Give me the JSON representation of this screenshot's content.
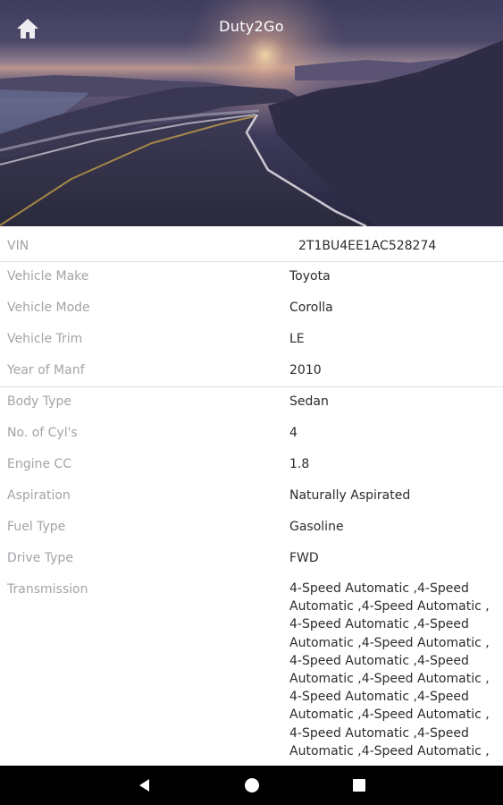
{
  "app": {
    "title": "Duty2Go"
  },
  "icons": {
    "home": "home-icon",
    "back": "back-triangle-icon",
    "home_nav": "home-circle-icon",
    "recents": "recents-square-icon"
  },
  "colors": {
    "label": "#a3a3a9",
    "value": "#2b2b2b",
    "divider": "#e0e0e0",
    "navbar": "#000000"
  },
  "vehicle": {
    "vin": {
      "label": "VIN",
      "value": "2T1BU4EE1AC528274"
    },
    "make": {
      "label": "Vehicle Make",
      "value": "Toyota"
    },
    "model": {
      "label": "Vehicle Mode",
      "value": "Corolla"
    },
    "trim": {
      "label": "Vehicle Trim",
      "value": "LE"
    },
    "year": {
      "label": "Year of Manf",
      "value": "2010"
    },
    "body": {
      "label": "Body Type",
      "value": "Sedan"
    },
    "cyl": {
      "label": "No. of Cyl's",
      "value": "4"
    },
    "cc": {
      "label": "Engine CC",
      "value": "1.8"
    },
    "aspiration": {
      "label": "Aspiration",
      "value": "Naturally Aspirated"
    },
    "fuel": {
      "label": "Fuel Type",
      "value": "Gasoline"
    },
    "drive": {
      "label": "Drive Type",
      "value": "FWD"
    },
    "transmission": {
      "label": "Transmission",
      "value": "4-Speed Automatic ,4-Speed Automatic ,4-Speed Automatic , 4-Speed Automatic ,4-Speed Automatic ,4-Speed Automatic , 4-Speed Automatic ,4-Speed Automatic ,4-Speed Automatic , 4-Speed Automatic ,4-Speed Automatic ,4-Speed Automatic , 4-Speed Automatic ,4-Speed Automatic ,4-Speed Automatic ,"
    }
  }
}
